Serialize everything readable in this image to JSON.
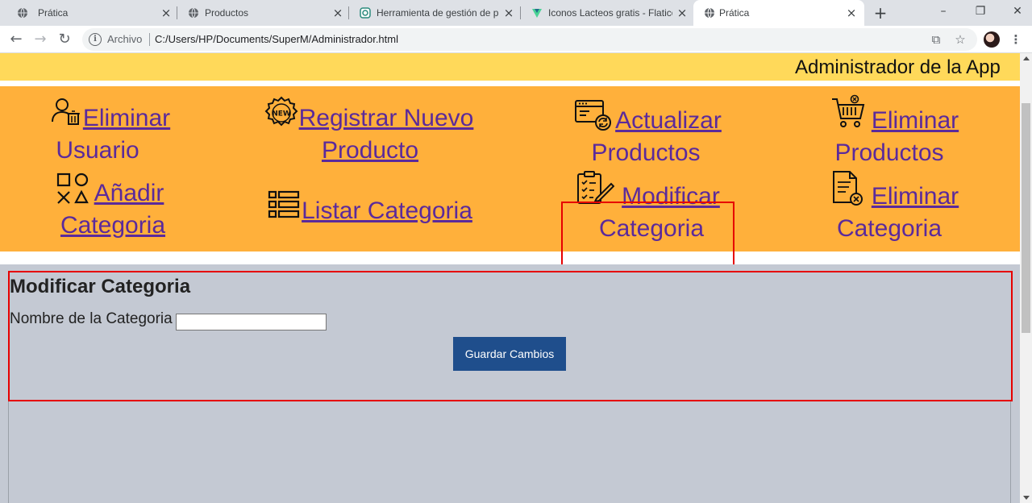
{
  "browser": {
    "tabs": [
      {
        "title": "Prática",
        "icon": "globe-icon",
        "active": false
      },
      {
        "title": "Productos",
        "icon": "globe-icon",
        "active": false
      },
      {
        "title": "Herramienta de gestión de pru",
        "icon": "app-icon",
        "active": false
      },
      {
        "title": "Iconos Lacteos gratis - Flaticon",
        "icon": "flaticon-icon",
        "active": false
      },
      {
        "title": "Prática",
        "icon": "globe-icon",
        "active": true
      }
    ],
    "new_tab": "+",
    "window_controls": {
      "minimize": "–",
      "restore": "❐",
      "close": "✕"
    },
    "toolbar": {
      "back": "←",
      "forward": "→",
      "reload": "↻",
      "scheme_label": "Archivo",
      "url": "C:/Users/HP/Documents/SuperM/Administrador.html",
      "translate": "⧉",
      "star": "☆",
      "menu": "⋮"
    }
  },
  "page": {
    "header_title": "Administrador de la App",
    "menu": [
      {
        "key": "eliminar-usuario",
        "line1": " Eliminar",
        "line2": "Usuario",
        "icon": "user-delete-icon"
      },
      {
        "key": "registrar-producto",
        "line1": " Registrar Nuevo",
        "line2": "Producto",
        "icon": "new-badge-icon"
      },
      {
        "key": "actualizar-productos",
        "line1": " Actualizar",
        "line2": "Productos",
        "icon": "update-window-icon"
      },
      {
        "key": "eliminar-productos",
        "line1": " Eliminar",
        "line2": "Productos",
        "icon": "shopping-cart-icon"
      },
      {
        "key": "anadir-categoria",
        "line1": " Añadir",
        "line2": "Categoria",
        "icon": "shapes-icon"
      },
      {
        "key": "listar-categoria",
        "line1": " Listar Categoria",
        "line2": "",
        "icon": "list-icon"
      },
      {
        "key": "modificar-categoria",
        "line1": " Modificar",
        "line2": "Categoria",
        "icon": "edit-checklist-icon"
      },
      {
        "key": "eliminar-categoria",
        "line1": " Eliminar",
        "line2": "Categoria",
        "icon": "document-delete-icon"
      }
    ],
    "form": {
      "title": "Modificar Categoria",
      "field_label": "Nombre de la Categoria",
      "field_value": "",
      "field_placeholder": "",
      "submit_label": "Guardar Cambios"
    },
    "colors": {
      "header_bg": "#ffd95a",
      "menu_bg": "#ffb03b",
      "link": "#5b2a9b",
      "panel_bg": "#c4c9d3",
      "button_bg": "#1f4e8c",
      "highlight": "#e60000"
    }
  }
}
